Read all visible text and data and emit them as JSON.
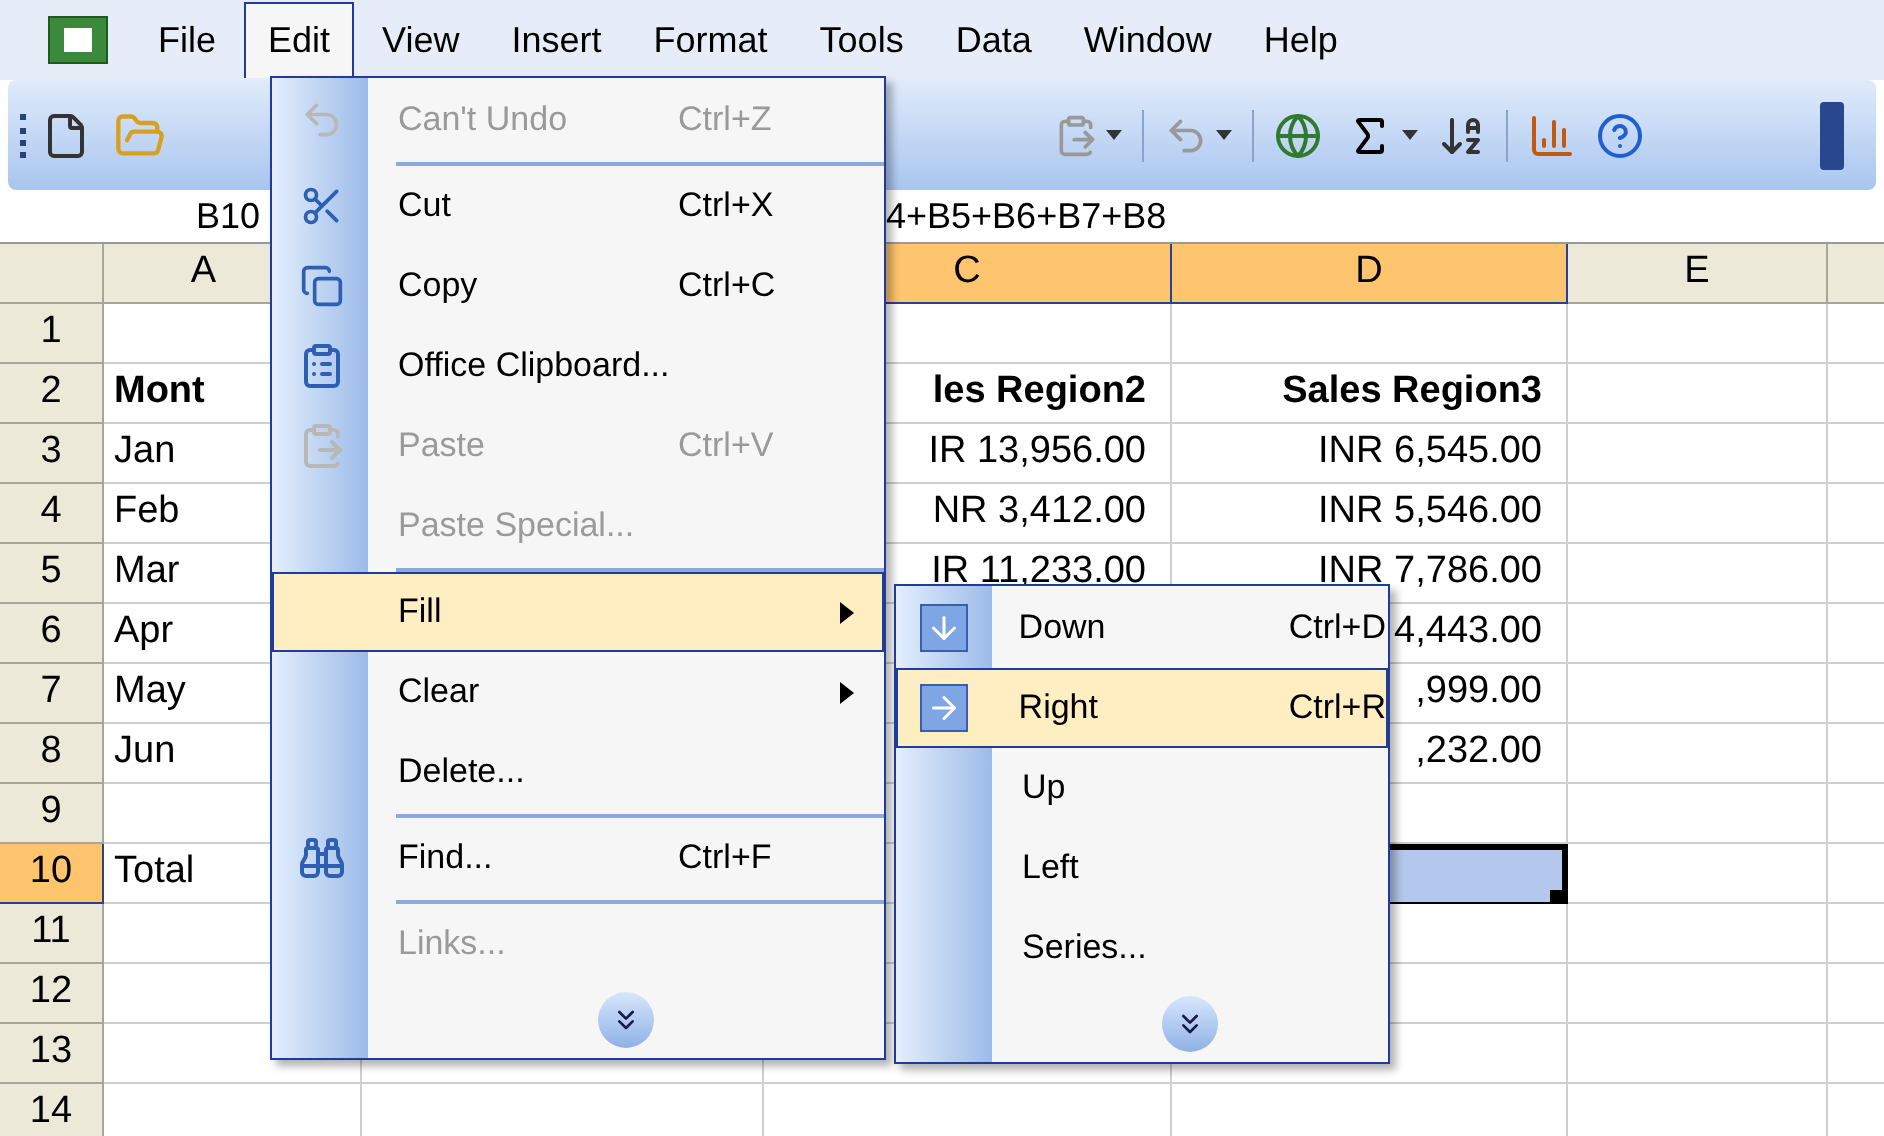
{
  "menubar": [
    {
      "label": "File",
      "selected": false
    },
    {
      "label": "Edit",
      "selected": true
    },
    {
      "label": "View",
      "selected": false
    },
    {
      "label": "Insert",
      "selected": false
    },
    {
      "label": "Format",
      "selected": false
    },
    {
      "label": "Tools",
      "selected": false
    },
    {
      "label": "Data",
      "selected": false
    },
    {
      "label": "Window",
      "selected": false
    },
    {
      "label": "Help",
      "selected": false
    }
  ],
  "formula_bar": {
    "name_box": "B10",
    "formula": "4+B5+B6+B7+B8"
  },
  "sheet": {
    "columns": [
      {
        "label": "A",
        "selected": false
      },
      {
        "label": "C",
        "selected": true
      },
      {
        "label": "D",
        "selected": true
      },
      {
        "label": "E",
        "selected": false
      }
    ],
    "rows": [
      {
        "header": "1",
        "selected": false,
        "cells": [
          null,
          null,
          null,
          null
        ]
      },
      {
        "header": "2",
        "selected": false,
        "cells": [
          {
            "text": "Mont",
            "bold": true
          },
          {
            "text": "les Region2",
            "bold": true
          },
          {
            "text": "Sales Region3",
            "bold": true
          },
          null
        ]
      },
      {
        "header": "3",
        "selected": false,
        "cells": [
          {
            "text": "Jan",
            "bold": false
          },
          {
            "text": "IR 13,956.00",
            "bold": false
          },
          {
            "text": "INR 6,545.00",
            "bold": false
          },
          null
        ]
      },
      {
        "header": "4",
        "selected": false,
        "cells": [
          {
            "text": "Feb",
            "bold": false
          },
          {
            "text": "NR 3,412.00",
            "bold": false
          },
          {
            "text": "INR 5,546.00",
            "bold": false
          },
          null
        ]
      },
      {
        "header": "5",
        "selected": false,
        "cells": [
          {
            "text": "Mar",
            "bold": false
          },
          {
            "text": "IR 11,233.00",
            "bold": false
          },
          {
            "text": "INR 7,786.00",
            "bold": false
          },
          null
        ]
      },
      {
        "header": "6",
        "selected": false,
        "cells": [
          {
            "text": "Apr",
            "bold": false
          },
          null,
          {
            "text": "4,443.00",
            "bold": false
          },
          null
        ]
      },
      {
        "header": "7",
        "selected": false,
        "cells": [
          {
            "text": "May",
            "bold": false
          },
          null,
          {
            "text": ",999.00",
            "bold": false
          },
          null
        ]
      },
      {
        "header": "8",
        "selected": false,
        "cells": [
          {
            "text": "Jun",
            "bold": false
          },
          null,
          {
            "text": ",232.00",
            "bold": false
          },
          null
        ]
      },
      {
        "header": "9",
        "selected": false,
        "cells": [
          null,
          null,
          null,
          null
        ]
      },
      {
        "header": "10",
        "selected": true,
        "cells": [
          {
            "text": "Total",
            "bold": false
          },
          null,
          {
            "selected": true
          },
          null
        ]
      },
      {
        "header": "11",
        "selected": false,
        "cells": [
          null,
          null,
          null,
          null
        ]
      },
      {
        "header": "12",
        "selected": false,
        "cells": [
          null,
          null,
          null,
          null
        ]
      },
      {
        "header": "13",
        "selected": false,
        "cells": [
          null,
          null,
          null,
          null
        ]
      },
      {
        "header": "14",
        "selected": false,
        "cells": [
          null,
          null,
          null,
          null
        ]
      }
    ]
  },
  "edit_menu": [
    {
      "kind": "item",
      "label": "Can't Undo",
      "shortcut": "Ctrl+Z",
      "disabled": true,
      "selected": false,
      "submenu": false
    },
    {
      "kind": "separator"
    },
    {
      "kind": "item",
      "label": "Cut",
      "shortcut": "Ctrl+X",
      "disabled": false,
      "selected": false,
      "submenu": false
    },
    {
      "kind": "item",
      "label": "Copy",
      "shortcut": "Ctrl+C",
      "disabled": false,
      "selected": false,
      "submenu": false
    },
    {
      "kind": "item",
      "label": "Office Clipboard...",
      "disabled": false,
      "selected": false,
      "submenu": false
    },
    {
      "kind": "item",
      "label": "Paste",
      "shortcut": "Ctrl+V",
      "disabled": true,
      "selected": false,
      "submenu": false
    },
    {
      "kind": "item",
      "label": "Paste Special...",
      "disabled": true,
      "selected": false,
      "submenu": false
    },
    {
      "kind": "separator"
    },
    {
      "kind": "item",
      "label": "Fill",
      "disabled": false,
      "selected": true,
      "submenu": true
    },
    {
      "kind": "item",
      "label": "Clear",
      "disabled": false,
      "selected": false,
      "submenu": true
    },
    {
      "kind": "item",
      "label": "Delete...",
      "disabled": false,
      "selected": false,
      "submenu": false
    },
    {
      "kind": "separator"
    },
    {
      "kind": "item",
      "label": "Find...",
      "shortcut": "Ctrl+F",
      "disabled": false,
      "selected": false,
      "submenu": false
    },
    {
      "kind": "separator"
    },
    {
      "kind": "item",
      "label": "Links...",
      "disabled": true,
      "selected": false,
      "submenu": false
    }
  ],
  "fill_submenu": [
    {
      "kind": "item",
      "label": "Down",
      "shortcut": "Ctrl+D",
      "disabled": false,
      "selected": false
    },
    {
      "kind": "item",
      "label": "Right",
      "shortcut": "Ctrl+R",
      "disabled": false,
      "selected": true
    },
    {
      "kind": "item",
      "label": "Up",
      "disabled": false,
      "selected": false
    },
    {
      "kind": "item",
      "label": "Left",
      "disabled": false,
      "selected": false
    },
    {
      "kind": "item",
      "label": "Series...",
      "disabled": false,
      "selected": false
    }
  ]
}
